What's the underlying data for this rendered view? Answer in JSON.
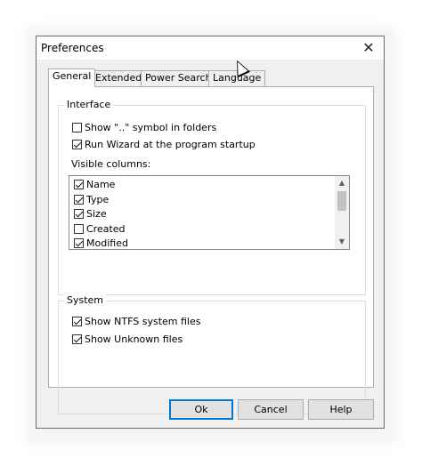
{
  "window": {
    "title": "Preferences",
    "close_glyph": "✕"
  },
  "tabs": [
    {
      "label": "General",
      "active": true
    },
    {
      "label": "Extended",
      "active": false
    },
    {
      "label": "Power Search",
      "active": false
    },
    {
      "label": "Language",
      "active": false
    }
  ],
  "interface": {
    "group_label": "Interface",
    "show_dots": {
      "label": "Show \"..\" symbol in folders",
      "checked": false
    },
    "run_wizard": {
      "label": "Run Wizard at the program startup",
      "checked": true
    },
    "visible_columns_label": "Visible columns:",
    "columns": [
      {
        "label": "Name",
        "checked": true
      },
      {
        "label": "Type",
        "checked": true
      },
      {
        "label": "Size",
        "checked": true
      },
      {
        "label": "Created",
        "checked": false
      },
      {
        "label": "Modified",
        "checked": true
      }
    ],
    "scroll_up_glyph": "▲",
    "scroll_down_glyph": "▼"
  },
  "system": {
    "group_label": "System",
    "show_ntfs": {
      "label": "Show NTFS system files",
      "checked": true
    },
    "show_unknown": {
      "label": "Show Unknown files",
      "checked": true
    }
  },
  "buttons": {
    "ok": "Ok",
    "cancel": "Cancel",
    "help": "Help"
  },
  "colors": {
    "accent": "#0078d7",
    "dialog_bg": "#f0f0f0"
  }
}
